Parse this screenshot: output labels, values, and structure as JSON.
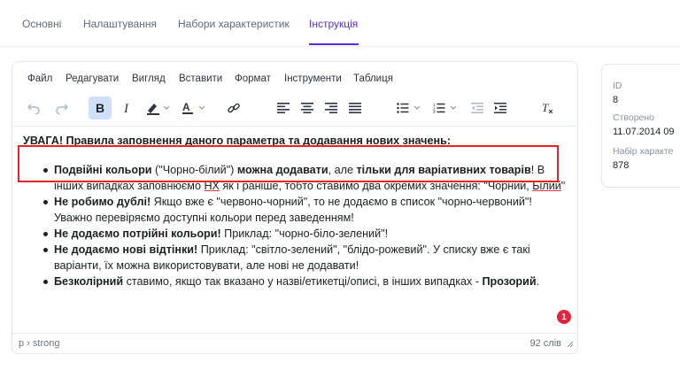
{
  "tabs": [
    {
      "label": "Основні"
    },
    {
      "label": "Налаштування"
    },
    {
      "label": "Набори характеристик"
    },
    {
      "label": "Інструкція",
      "active": true
    }
  ],
  "menu": [
    "Файл",
    "Редагувати",
    "Вигляд",
    "Вставити",
    "Формат",
    "Інструменти",
    "Таблиця"
  ],
  "content": {
    "heading": "УВАГА! Правила заповнення даного параметра та додавання нових значень:",
    "items": [
      {
        "b1": "Подвійні кольори",
        "t1": " (\"Чорно-білий\") ",
        "b2": "можна додавати",
        "t2": ", але ",
        "b3": "тільки для варіативних товарів",
        "t3": "! В інших випадках заповнюємо ",
        "u1": "НХ",
        "t4": " як і раніше, тобто ставимо два окремих значення: \"Чорний, ",
        "u2": "Білий",
        "t5": "\""
      },
      {
        "b1": "Не робимо дублі!",
        "t1": " Якщо вже є \"червоно-чорний\", то не додаємо в список \"чорно-червоний\"! Уважно перевіряємо доступні кольори перед заведенням!"
      },
      {
        "b1": "Не додаємо потрійні кольори!",
        "t1": " Приклад: \"чорно-біло-зелений\"!"
      },
      {
        "b1": "Не додаємо нові відтінки!",
        "t1": " Приклад: \"світло-зелений\", \"блідо-рожевий\". У списку вже є такі варіанти, їх можна використовувати, але нові не додавати!"
      },
      {
        "b1": "Безколірний",
        "t1": " ставимо, якщо так вказано у назві/етикетці/описі, в інших випадках - ",
        "b2": "Прозорий",
        "t2": "."
      }
    ]
  },
  "status": {
    "path": "p › strong",
    "word_count": "92 слів"
  },
  "badge": "1",
  "side": {
    "id_label": "ID",
    "id_value": "8",
    "created_label": "Створено",
    "created_value": "11.07.2014 09",
    "set_label": "Набір характе",
    "set_value": "878"
  },
  "colors": {
    "accent": "#5b2bd9",
    "active_button": "#cfe0fb",
    "highlight": "#e02626",
    "badge": "#e0263f"
  }
}
